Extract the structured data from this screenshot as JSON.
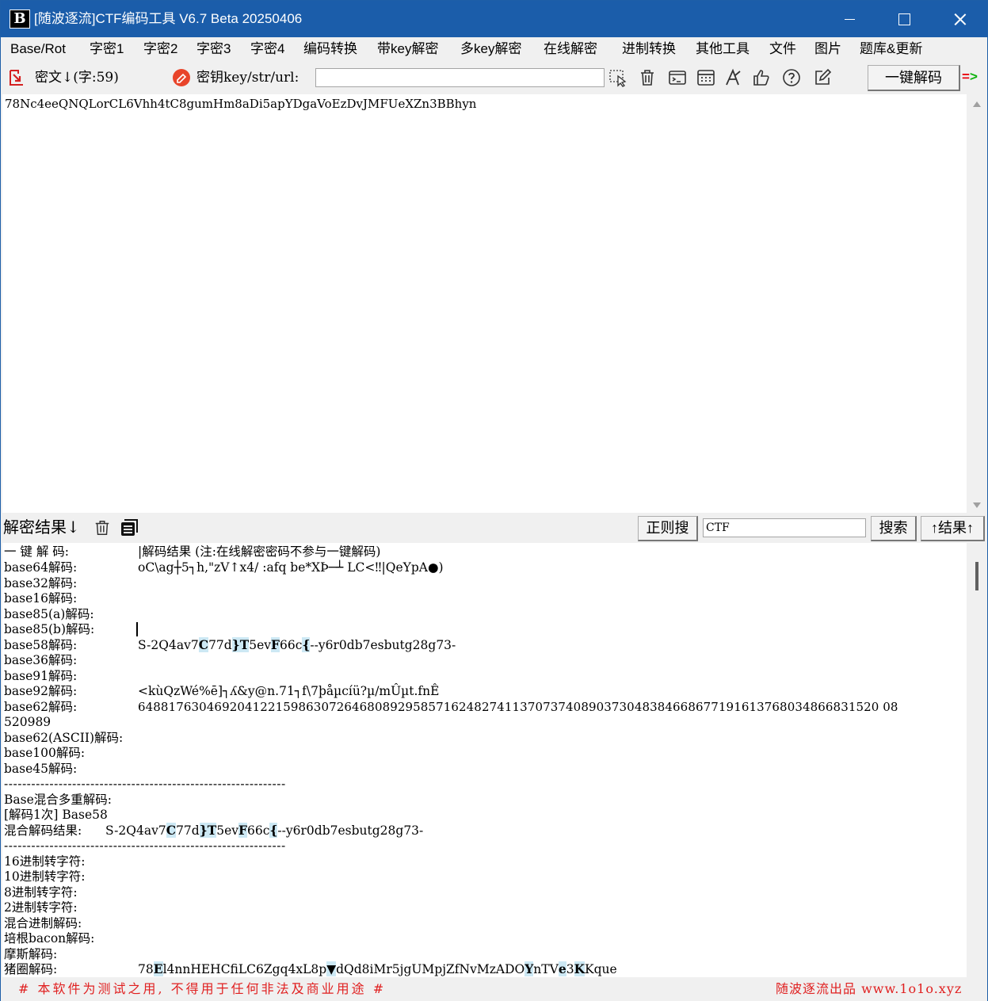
{
  "window": {
    "title": "[随波逐流]CTF编码工具 V6.7 Beta 20250406",
    "logo_letter": "B"
  },
  "menu": [
    "Base/Rot",
    "字密1",
    "字密2",
    "字密3",
    "字密4",
    "编码转换",
    "带key解密",
    "多key解密",
    "在线解密",
    "进制转换",
    "其他工具",
    "文件",
    "图片",
    "题库&更新"
  ],
  "toolbar": {
    "cipher_label": "密文↓(字:59)",
    "key_label": "密钥key/str/url:",
    "key_value": "",
    "onekey_button": "一键解码",
    "arrow_label": "=",
    "arrow_tip": ">",
    "icons": [
      "cursor-select-icon",
      "trash-icon",
      "terminal-icon",
      "calculator-icon",
      "font-icon",
      "thumbs-up-icon",
      "help-icon",
      "edit-icon"
    ]
  },
  "cipher": {
    "text": "78Nc4eeQNQLorCL6Vhh4tC8gumHm8aDi5apYDgaVoEzDvJMFUeXZn3BBhyn"
  },
  "result_bar": {
    "label": "解密结果↓",
    "regex_button": "正则搜",
    "search_value": "CTF",
    "search_button": "搜索",
    "up_button": "↑结果↑"
  },
  "results": {
    "header_left": "一 键 解 码:",
    "header_right": "|解码结果 (注:在线解密密码不参与一键解码)",
    "rows": [
      {
        "label": "base64解码:",
        "value": "oC\\ag┼5┐h,\"zV↑x4/ :afq be*XÞ─┴ LC<‼|QeYpA●)"
      },
      {
        "label": "base32解码:",
        "value": ""
      },
      {
        "label": "base16解码:",
        "value": ""
      },
      {
        "label": "base85(a)解码:",
        "value": ""
      },
      {
        "label": "base85(b)解码:",
        "value": ""
      },
      {
        "label": "base58解码:",
        "value": "S-2Q4av7C77d}T5evF66c{--y6r0db7esbutg28g73-"
      },
      {
        "label": "base36解码:",
        "value": ""
      },
      {
        "label": "base91解码:",
        "value": ""
      },
      {
        "label": "base92解码:",
        "value": "<kùQzWé%ē]┐ʎ&y@n.71┐f\\7þåµcíü?µ/mÛµt.fnÊ"
      },
      {
        "label": "base62解码:",
        "value": "6488176304692041221598630726468089295857162482741137073740890373048384668677191613768034866831520 08"
      },
      {
        "label": "",
        "value": "520989"
      },
      {
        "label": "base62(ASCII)解码:",
        "value": ""
      },
      {
        "label": "base100解码:",
        "value": ""
      },
      {
        "label": "base45解码:",
        "value": ""
      }
    ],
    "separator": "--------------------------------------------------------------",
    "mixed_title": "Base混合多重解码:",
    "mixed_step": "[解码1次] Base58",
    "mixed_result_label": "混合解码结果:",
    "mixed_result_value": "S-2Q4av7C77d}T5evF66c{--y6r0db7esbutg28g73-",
    "conv_rows": [
      {
        "label": "16进制转字符:",
        "value": ""
      },
      {
        "label": "10进制转字符:",
        "value": ""
      },
      {
        "label": "8进制转字符:",
        "value": ""
      },
      {
        "label": "2进制转字符:",
        "value": ""
      },
      {
        "label": "混合进制解码:",
        "value": ""
      },
      {
        "label": "培根bacon解码:",
        "value": ""
      },
      {
        "label": "摩斯解码:",
        "value": ""
      },
      {
        "label": "猪圈解码:",
        "value": "78El4nnHEHCfiLC6Zgq4xL8p▼dQd8iMr5jgUMpjZfNvMzADOYnTVe3KKque"
      }
    ]
  },
  "footer": {
    "left": "# 本软件为测试之用, 不得用于任何非法及商业用途 #",
    "right": "随波逐流出品 www.1o1o.xyz"
  },
  "colors": {
    "titlebar": "#1b5daa",
    "highlight": "#cce8f4",
    "footer_text": "#e02020"
  }
}
